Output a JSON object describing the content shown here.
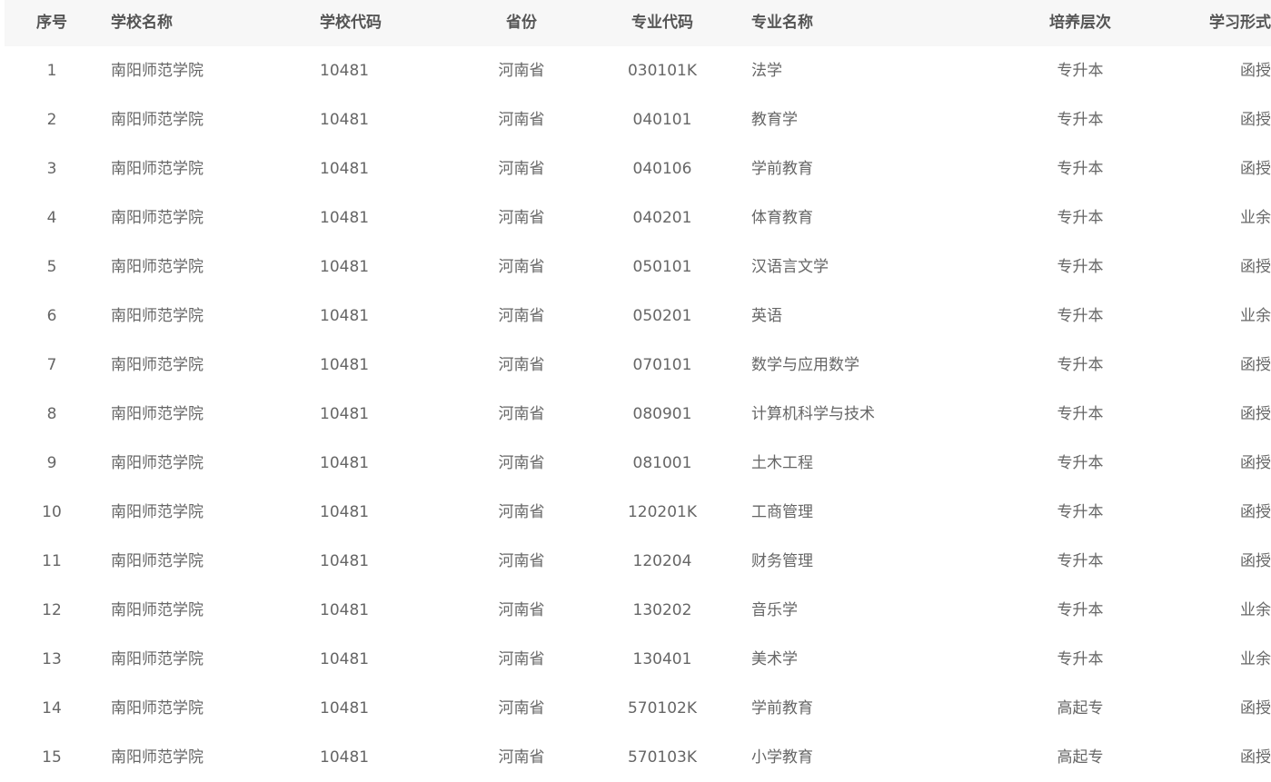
{
  "table": {
    "headers": {
      "index": "序号",
      "school_name": "学校名称",
      "school_code": "学校代码",
      "province": "省份",
      "major_code": "专业代码",
      "major_name": "专业名称",
      "level": "培养层次",
      "study_mode": "学习形式"
    },
    "rows": [
      {
        "index": "1",
        "school_name": "南阳师范学院",
        "school_code": "10481",
        "province": "河南省",
        "major_code": "030101K",
        "major_name": "法学",
        "level": "专升本",
        "study_mode": "函授"
      },
      {
        "index": "2",
        "school_name": "南阳师范学院",
        "school_code": "10481",
        "province": "河南省",
        "major_code": "040101",
        "major_name": "教育学",
        "level": "专升本",
        "study_mode": "函授"
      },
      {
        "index": "3",
        "school_name": "南阳师范学院",
        "school_code": "10481",
        "province": "河南省",
        "major_code": "040106",
        "major_name": "学前教育",
        "level": "专升本",
        "study_mode": "函授"
      },
      {
        "index": "4",
        "school_name": "南阳师范学院",
        "school_code": "10481",
        "province": "河南省",
        "major_code": "040201",
        "major_name": "体育教育",
        "level": "专升本",
        "study_mode": "业余"
      },
      {
        "index": "5",
        "school_name": "南阳师范学院",
        "school_code": "10481",
        "province": "河南省",
        "major_code": "050101",
        "major_name": "汉语言文学",
        "level": "专升本",
        "study_mode": "函授"
      },
      {
        "index": "6",
        "school_name": "南阳师范学院",
        "school_code": "10481",
        "province": "河南省",
        "major_code": "050201",
        "major_name": "英语",
        "level": "专升本",
        "study_mode": "业余"
      },
      {
        "index": "7",
        "school_name": "南阳师范学院",
        "school_code": "10481",
        "province": "河南省",
        "major_code": "070101",
        "major_name": "数学与应用数学",
        "level": "专升本",
        "study_mode": "函授"
      },
      {
        "index": "8",
        "school_name": "南阳师范学院",
        "school_code": "10481",
        "province": "河南省",
        "major_code": "080901",
        "major_name": "计算机科学与技术",
        "level": "专升本",
        "study_mode": "函授"
      },
      {
        "index": "9",
        "school_name": "南阳师范学院",
        "school_code": "10481",
        "province": "河南省",
        "major_code": "081001",
        "major_name": "土木工程",
        "level": "专升本",
        "study_mode": "函授"
      },
      {
        "index": "10",
        "school_name": "南阳师范学院",
        "school_code": "10481",
        "province": "河南省",
        "major_code": "120201K",
        "major_name": "工商管理",
        "level": "专升本",
        "study_mode": "函授"
      },
      {
        "index": "11",
        "school_name": "南阳师范学院",
        "school_code": "10481",
        "province": "河南省",
        "major_code": "120204",
        "major_name": "财务管理",
        "level": "专升本",
        "study_mode": "函授"
      },
      {
        "index": "12",
        "school_name": "南阳师范学院",
        "school_code": "10481",
        "province": "河南省",
        "major_code": "130202",
        "major_name": "音乐学",
        "level": "专升本",
        "study_mode": "业余"
      },
      {
        "index": "13",
        "school_name": "南阳师范学院",
        "school_code": "10481",
        "province": "河南省",
        "major_code": "130401",
        "major_name": "美术学",
        "level": "专升本",
        "study_mode": "业余"
      },
      {
        "index": "14",
        "school_name": "南阳师范学院",
        "school_code": "10481",
        "province": "河南省",
        "major_code": "570102K",
        "major_name": "学前教育",
        "level": "高起专",
        "study_mode": "函授"
      },
      {
        "index": "15",
        "school_name": "南阳师范学院",
        "school_code": "10481",
        "province": "河南省",
        "major_code": "570103K",
        "major_name": "小学教育",
        "level": "高起专",
        "study_mode": "函授"
      }
    ]
  }
}
